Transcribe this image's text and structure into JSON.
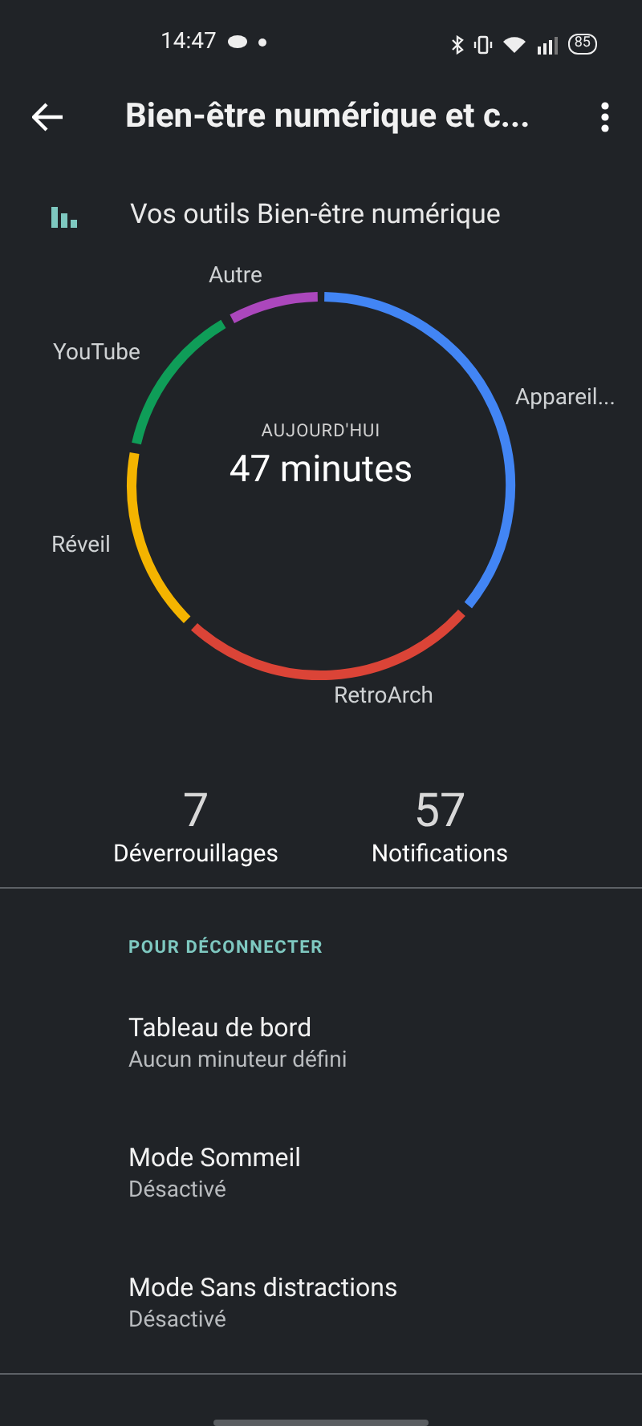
{
  "status_bar": {
    "time": "14:47",
    "battery": "85"
  },
  "app_bar": {
    "title": "Bien-être numérique et c..."
  },
  "tools_link": {
    "label": "Vos outils Bien-être numérique"
  },
  "usage": {
    "caption": "AUJOURD'HUI",
    "total": "47 minutes",
    "segments": [
      {
        "label": "Appareil...",
        "color": "#4285f4"
      },
      {
        "label": "RetroArch",
        "color": "#db4437"
      },
      {
        "label": "Réveil",
        "color": "#f4b400"
      },
      {
        "label": "YouTube",
        "color": "#0f9d58"
      },
      {
        "label": "Autre",
        "color": "#ab47bc"
      }
    ]
  },
  "stats": [
    {
      "value": "7",
      "label": "Déverrouillages"
    },
    {
      "value": "57",
      "label": "Notifications"
    }
  ],
  "section": {
    "header": "POUR DÉCONNECTER",
    "items": [
      {
        "title": "Tableau de bord",
        "subtitle": "Aucun minuteur défini"
      },
      {
        "title": "Mode Sommeil",
        "subtitle": "Désactivé"
      },
      {
        "title": "Mode Sans distractions",
        "subtitle": "Désactivé"
      }
    ]
  }
}
